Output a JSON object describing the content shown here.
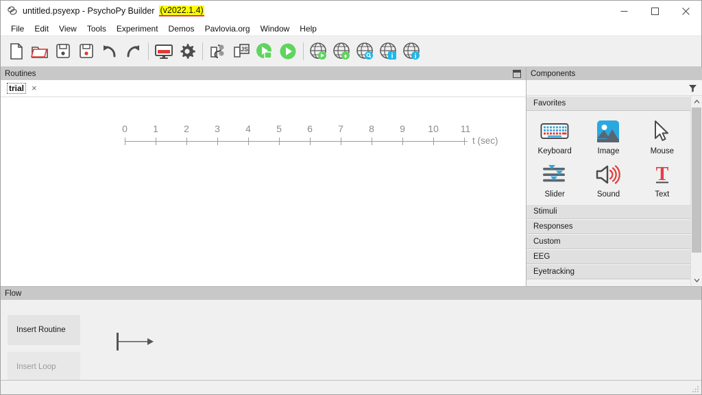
{
  "window": {
    "title": "untitled.psyexp - PsychoPy Builder",
    "version": "(v2022.1.4)",
    "logo_icon": "psychopy-logo-icon",
    "minimize_label": "–",
    "maximize_label": "□",
    "close_label": "×",
    "highlight_color": "#ffff00",
    "underline_color": "#e03b34"
  },
  "menubar": {
    "items": [
      {
        "label": "File"
      },
      {
        "label": "Edit"
      },
      {
        "label": "View"
      },
      {
        "label": "Tools"
      },
      {
        "label": "Experiment"
      },
      {
        "label": "Demos"
      },
      {
        "label": "Pavlovia.org"
      },
      {
        "label": "Window"
      },
      {
        "label": "Help"
      }
    ]
  },
  "toolbar": {
    "buttons": [
      {
        "name": "new-file-button",
        "icon": "new-document-icon",
        "tooltip": "New"
      },
      {
        "name": "open-file-button",
        "icon": "open-folder-icon",
        "tooltip": "Open"
      },
      {
        "name": "save-file-button",
        "icon": "save-disk-icon",
        "tooltip": "Save"
      },
      {
        "name": "save-as-button",
        "icon": "save-as-disk-icon",
        "tooltip": "Save as"
      },
      {
        "name": "undo-button",
        "icon": "undo-arrow-icon",
        "tooltip": "Undo"
      },
      {
        "name": "redo-button",
        "icon": "redo-arrow-icon",
        "tooltip": "Redo"
      },
      {
        "name": "monitor-center-button",
        "icon": "monitor-icon",
        "tooltip": "Monitor Center"
      },
      {
        "name": "experiment-settings-button",
        "icon": "gear-icon",
        "tooltip": "Experiment settings"
      },
      {
        "name": "compile-python-button",
        "icon": "python-script-icon",
        "tooltip": "Compile to Python"
      },
      {
        "name": "compile-js-button",
        "icon": "js-script-icon",
        "tooltip": "Compile to JS"
      },
      {
        "name": "run-local-button",
        "icon": "run-green-play-icon",
        "tooltip": "Run"
      },
      {
        "name": "run-online-button",
        "icon": "play-green-circle-icon",
        "tooltip": "Run online"
      },
      {
        "name": "pavlovia-run-button",
        "icon": "globe-play-icon",
        "tooltip": "Run on Pavlovia"
      },
      {
        "name": "pavlovia-sync-button",
        "icon": "globe-sync-icon",
        "tooltip": "Sync with Pavlovia"
      },
      {
        "name": "pavlovia-search-button",
        "icon": "globe-search-icon",
        "tooltip": "Search Pavlovia"
      },
      {
        "name": "pavlovia-user-button",
        "icon": "globe-user-icon",
        "tooltip": "Pavlovia user"
      },
      {
        "name": "pavlovia-info-button",
        "icon": "globe-info-icon",
        "tooltip": "Pavlovia info"
      }
    ]
  },
  "routines": {
    "header": "Routines",
    "dock_icon": "panel-dock-icon",
    "tabs": [
      {
        "label": "trial",
        "close_label": "×"
      }
    ],
    "timeline": {
      "ticks": [
        "0",
        "1",
        "2",
        "3",
        "4",
        "5",
        "6",
        "7",
        "8",
        "9",
        "10",
        "11"
      ],
      "unit_label": "t (sec)"
    }
  },
  "components": {
    "header": "Components",
    "filter_icon": "filter-funnel-icon",
    "scroll_up_icon": "chevron-up-icon",
    "scroll_down_icon": "chevron-down-icon",
    "favorites": {
      "title": "Favorites",
      "items": [
        {
          "label": "Keyboard",
          "icon": "keyboard-icon"
        },
        {
          "label": "Image",
          "icon": "image-icon"
        },
        {
          "label": "Mouse",
          "icon": "mouse-cursor-icon"
        },
        {
          "label": "Slider",
          "icon": "slider-icon"
        },
        {
          "label": "Sound",
          "icon": "speaker-icon"
        },
        {
          "label": "Text",
          "icon": "text-t-icon"
        }
      ]
    },
    "categories": [
      {
        "label": "Stimuli"
      },
      {
        "label": "Responses"
      },
      {
        "label": "Custom"
      },
      {
        "label": "EEG"
      },
      {
        "label": "Eyetracking"
      }
    ]
  },
  "flow": {
    "header": "Flow",
    "insert_routine_label": "Insert Routine",
    "insert_loop_label": "Insert Loop",
    "diagram_icon": "flow-arrow-icon"
  },
  "statusbar": {
    "text": "",
    "grip_icon": "resize-grip-icon"
  }
}
